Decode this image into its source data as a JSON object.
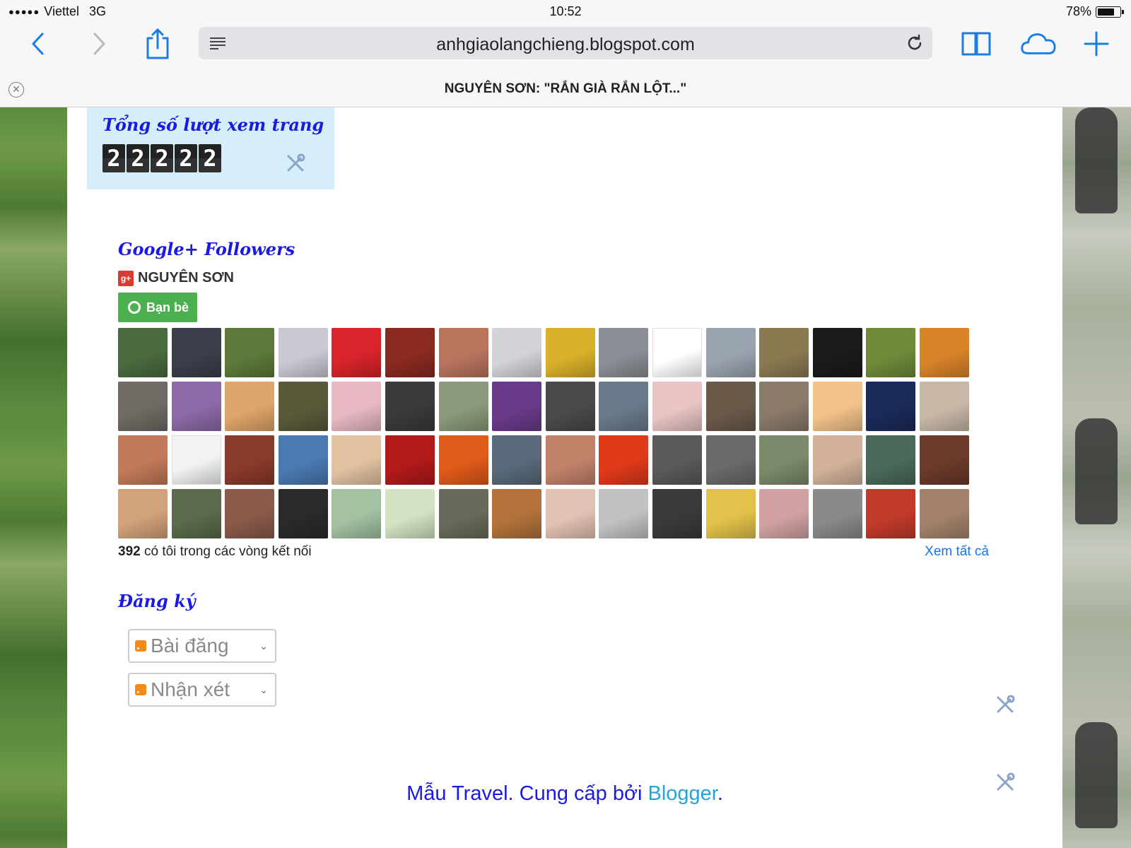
{
  "status_bar": {
    "signal": "●●●●●",
    "carrier": "Viettel",
    "network": "3G",
    "time": "10:52",
    "battery": "78%",
    "battery_level": 0.78
  },
  "browser": {
    "url": "anhgiaolangchieng.blogspot.com",
    "tab_title": "NGUYÊN SƠN: \"RẮN GIÀ RẮN LỘT...\"",
    "icons": [
      "back-icon",
      "forward-icon",
      "share-icon",
      "reader-icon",
      "reload-icon",
      "bookmarks-icon",
      "cloud-tabs-icon",
      "new-tab-icon",
      "tab-close-icon"
    ]
  },
  "counter_widget": {
    "title": "Tổng số lượt xem trang",
    "digits": [
      "2",
      "2",
      "2",
      "2",
      "2"
    ]
  },
  "followers_widget": {
    "title": "Google+ Followers",
    "badge": "g+",
    "profile_name": "NGUYÊN SƠN",
    "friends_button": "Bạn bè",
    "count": "392",
    "count_text": " có tôi trong các vòng kết nối",
    "see_all": "Xem tất cả",
    "avatar_colors": [
      "#4a6b3f",
      "#3a3f4a",
      "#5d7a3a",
      "#c9c9d4",
      "#d8242a",
      "#8a2a20",
      "#b9745e",
      "#d2d4d8",
      "#d9b12a",
      "#8a8f95",
      "#ffffff",
      "#9aa4b0",
      "#8a7a52",
      "#1a1a1a",
      "#6f8a3a",
      "#d9842a",
      "#6f6a63",
      "#8c6aa8",
      "#e0a56a",
      "#5a5a3a",
      "#e8b9c2",
      "#3a3a3a",
      "#8a9a7a",
      "#6a3a8a",
      "#4a4a4a",
      "#6a7a8a",
      "#e8c4c4",
      "#6a5a4a",
      "#8a7a6a",
      "#f2c28a",
      "#1a2a5a",
      "#c8b8a8",
      "#c27a5a",
      "#f2f2f2",
      "#8a3a2a",
      "#4a7ab2",
      "#e2c2a2",
      "#b21a1a",
      "#e05a1a",
      "#5a6a7a",
      "#c2826a",
      "#e03a1a",
      "#5a5a5a",
      "#6a6a6a",
      "#7a8a6a",
      "#d2b29a",
      "#4a6a5a",
      "#6a3a2a",
      "#d2a27a",
      "#5a6a4a",
      "#8a5a4a",
      "#2a2a2a",
      "#a2c2a2",
      "#d2e2c2",
      "#6a6a5a",
      "#b2723a",
      "#e2c2b2",
      "#c2c2c2",
      "#3a3a3a",
      "#e2c24a",
      "#d2a2a2",
      "#8a8a8a",
      "#c23a2a",
      "#a2826a"
    ]
  },
  "subscribe_widget": {
    "title": "Đăng ký",
    "options": [
      "Bài đăng",
      "Nhận xét"
    ]
  },
  "footer": {
    "text": "Mẫu Travel. Cung cấp bởi ",
    "link": "Blogger",
    "suffix": "."
  }
}
